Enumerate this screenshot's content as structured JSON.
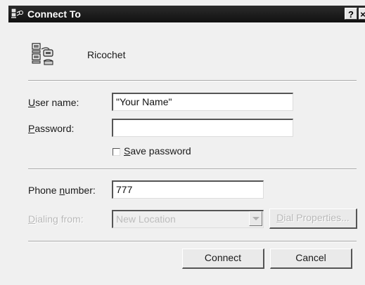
{
  "window": {
    "title": "Connect To",
    "help_button": "?",
    "close_button": "×"
  },
  "connection": {
    "name": "Ricochet",
    "icon": "dialup-connection-icon"
  },
  "fields": {
    "username": {
      "label_key": "U",
      "label_rest": "ser name:",
      "value": "\"Your Name\""
    },
    "password": {
      "label_key": "P",
      "label_rest": "assword:",
      "value": ""
    },
    "save_password": {
      "label_key": "S",
      "label_rest": "ave password",
      "checked": false
    },
    "phone": {
      "label_pre": "Phone ",
      "label_key": "n",
      "label_rest": "umber:",
      "value": "777"
    },
    "dialing_from": {
      "label_key": "D",
      "label_rest": "ialing from:",
      "value": "New Location",
      "disabled": true
    }
  },
  "buttons": {
    "dial_properties": {
      "label_key": "D",
      "label_rest": "ial Properties...",
      "disabled": true
    },
    "connect": "Connect",
    "cancel": "Cancel"
  }
}
